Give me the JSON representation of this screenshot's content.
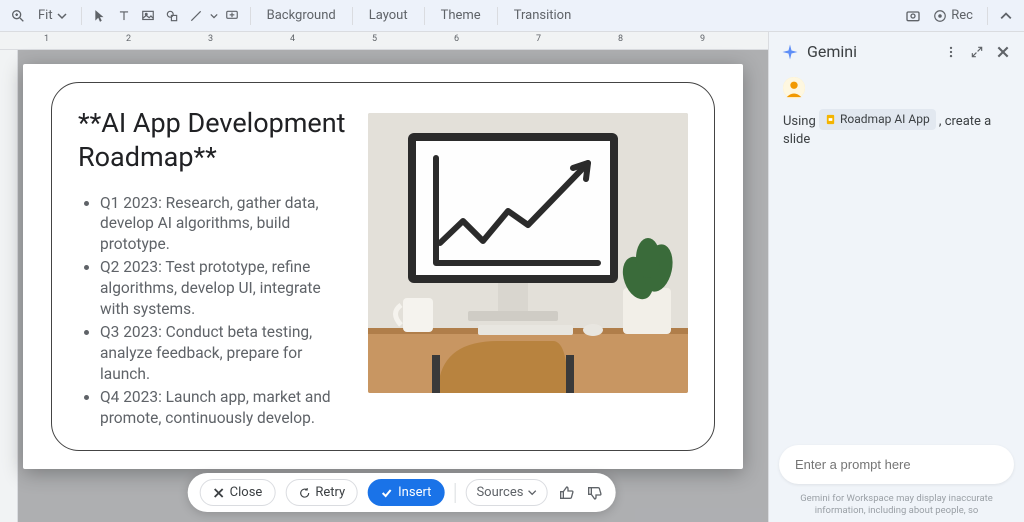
{
  "toolbar": {
    "zoom_label": "Fit",
    "background": "Background",
    "layout": "Layout",
    "theme": "Theme",
    "transition": "Transition",
    "rec": "Rec"
  },
  "ruler": {
    "ticks": [
      "1",
      "2",
      "3",
      "4",
      "5",
      "6",
      "7",
      "8",
      "9"
    ]
  },
  "slide": {
    "title": "**AI App Development Roadmap**",
    "bullets": [
      "Q1 2023: Research, gather data, develop AI algorithms, build prototype.",
      "Q2 2023: Test prototype, refine algorithms, develop UI, integrate with systems.",
      "Q3 2023: Conduct beta testing, analyze feedback, prepare for launch.",
      "Q4 2023: Launch app, market and promote, continuously develop."
    ]
  },
  "action_bar": {
    "close": "Close",
    "retry": "Retry",
    "insert": "Insert",
    "sources": "Sources"
  },
  "side_panel": {
    "title": "Gemini",
    "using_text": "Using",
    "chip": "Roadmap AI App",
    "prompt_suffix": ", create a slide",
    "input_placeholder": "Enter a prompt here",
    "disclaimer": "Gemini for Workspace may display inaccurate information, including about people, so"
  }
}
